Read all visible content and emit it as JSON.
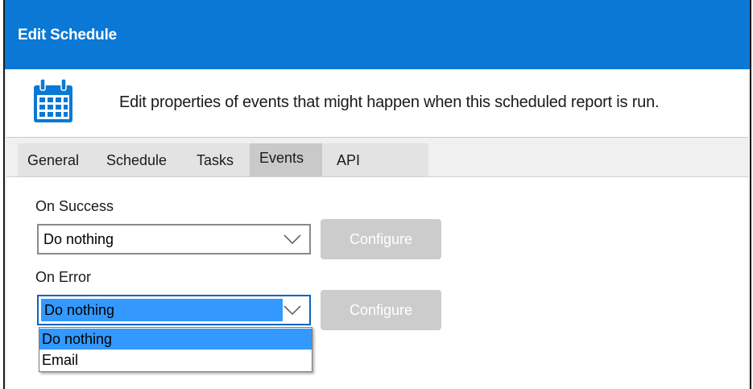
{
  "window": {
    "title": "Edit Schedule"
  },
  "header": {
    "icon": "calendar-icon",
    "description": "Edit properties of events that might happen when this scheduled report is run."
  },
  "tabs": [
    {
      "label": "General",
      "active": false
    },
    {
      "label": "Schedule",
      "active": false
    },
    {
      "label": "Tasks",
      "active": false
    },
    {
      "label": "Events",
      "active": true
    },
    {
      "label": "API",
      "active": false
    }
  ],
  "events": {
    "on_success": {
      "label": "On Success",
      "value": "Do nothing",
      "configure_label": "Configure"
    },
    "on_error": {
      "label": "On Error",
      "value": "Do nothing",
      "configure_label": "Configure",
      "options": [
        "Do nothing",
        "Email"
      ],
      "highlighted_option": "Do nothing"
    }
  },
  "colors": {
    "title_bar": "#0a78d4",
    "selection": "#3399ff",
    "disabled_button": "#cccccc"
  }
}
